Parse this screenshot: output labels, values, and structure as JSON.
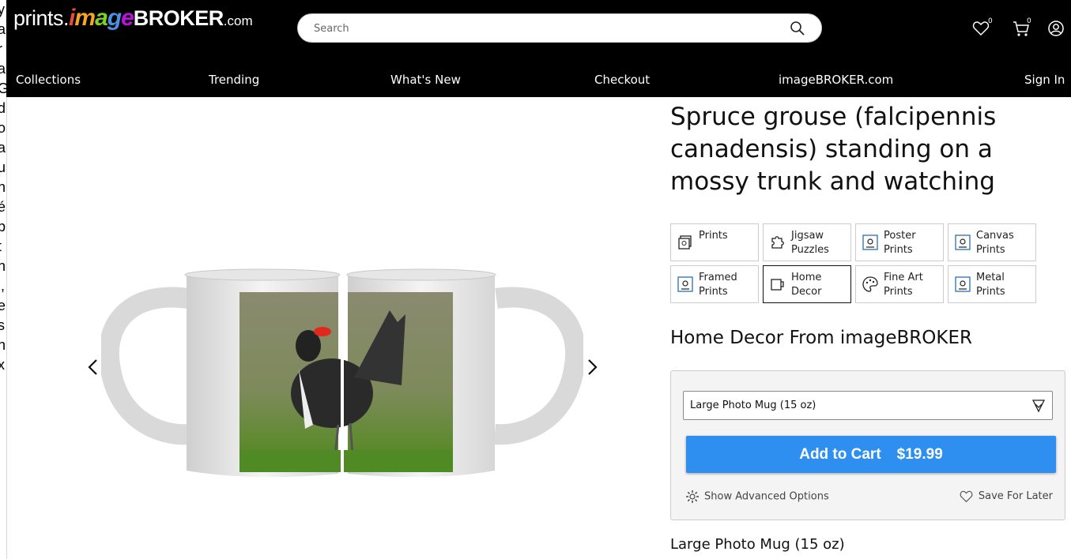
{
  "side_strip": {
    "lines": [
      "y",
      "a",
      "r",
      "a",
      "G",
      "d",
      "o",
      "a",
      "u",
      "n",
      "é",
      "",
      "p",
      "t",
      "n",
      "i,",
      "e",
      "s",
      "n",
      "x"
    ]
  },
  "header": {
    "logo": {
      "part1": "prints.",
      "part2": "image",
      "part3": "BROKER",
      "part4": ".com"
    },
    "search": {
      "placeholder": "Search"
    },
    "wishlist_count": "0",
    "cart_count": "0",
    "nav": [
      "Collections",
      "Trending",
      "What's New",
      "Checkout",
      "imageBROKER.com",
      "Sign In"
    ]
  },
  "product": {
    "title": "Spruce grouse (falcipennis canadensis) standing on a mossy trunk and watching",
    "categories": [
      {
        "label": "Prints",
        "icon": "prints-icon"
      },
      {
        "label": "Jigsaw Puzzles",
        "icon": "puzzle-icon"
      },
      {
        "label": "Poster Prints",
        "icon": "poster-icon"
      },
      {
        "label": "Canvas Prints",
        "icon": "canvas-icon"
      },
      {
        "label": "Framed Prints",
        "icon": "framed-icon"
      },
      {
        "label": "Home Decor",
        "icon": "mug-icon",
        "active": true
      },
      {
        "label": "Fine Art Prints",
        "icon": "palette-icon"
      },
      {
        "label": "Metal Prints",
        "icon": "metal-icon"
      }
    ],
    "subheading": "Home Decor From imageBROKER",
    "selected_option": "Large Photo Mug (15 oz)",
    "add_to_cart_label": "Add to Cart",
    "price": "$19.99",
    "advanced_label": "Show Advanced Options",
    "save_label": "Save For Later",
    "bottom_title": "Large Photo Mug (15 oz)"
  },
  "colors": {
    "accent": "#2f8ff0",
    "header_bg": "#000000"
  }
}
